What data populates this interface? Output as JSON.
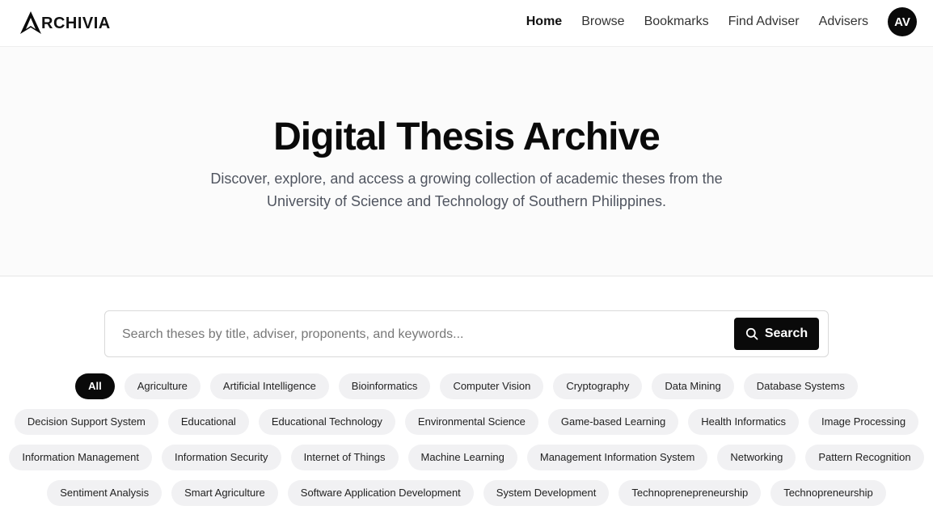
{
  "brand": {
    "name": "RCHIVIA",
    "logo_icon": "archivia-a-logo"
  },
  "nav": {
    "items": [
      {
        "label": "Home",
        "active": true
      },
      {
        "label": "Browse"
      },
      {
        "label": "Bookmarks"
      },
      {
        "label": "Find Adviser"
      },
      {
        "label": "Advisers"
      }
    ],
    "avatar_initials": "AV"
  },
  "hero": {
    "title": "Digital Thesis Archive",
    "subtitle_line1": "Discover, explore, and access a growing collection of academic theses from the",
    "subtitle_line2": "University of Science and Technology of Southern Philippines."
  },
  "search": {
    "placeholder": "Search theses by title, adviser, proponents, and keywords...",
    "button_label": "Search",
    "button_icon": "search-icon"
  },
  "tags": {
    "rows": [
      [
        "All",
        "Agriculture",
        "Artificial Intelligence",
        "Bioinformatics",
        "Computer Vision",
        "Cryptography",
        "Data Mining",
        "Database Systems"
      ],
      [
        "Decision Support System",
        "Educational",
        "Educational Technology",
        "Environmental Science",
        "Game-based Learning",
        "Health Informatics",
        "Image Processing"
      ],
      [
        "Information Management",
        "Information Security",
        "Internet of Things",
        "Machine Learning",
        "Management Information System",
        "Networking",
        "Pattern Recognition"
      ],
      [
        "Sentiment Analysis",
        "Smart Agriculture",
        "Software Application Development",
        "System Development",
        "Technoprenepreneurship",
        "Technopreneurship"
      ]
    ],
    "selected": "All"
  },
  "colors": {
    "accent": "#0a0a0a",
    "chip_bg": "#f1f1f3",
    "hero_bg": "#fbfbfb"
  }
}
